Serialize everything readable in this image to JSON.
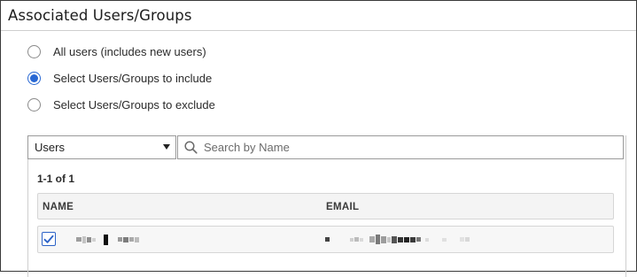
{
  "header": {
    "title": "Associated Users/Groups"
  },
  "options": [
    {
      "label": "All users (includes new users)",
      "selected": false
    },
    {
      "label": "Select Users/Groups to include",
      "selected": true
    },
    {
      "label": "Select Users/Groups to exclude",
      "selected": false
    }
  ],
  "filter": {
    "type_selected": "Users",
    "search_placeholder": "Search by Name"
  },
  "results": {
    "count_text": "1-1 of 1"
  },
  "table": {
    "columns": [
      "NAME",
      "EMAIL"
    ],
    "rows": [
      {
        "checked": true,
        "name": "",
        "email": ""
      }
    ]
  },
  "colors": {
    "accent": "#2867d3",
    "border": "#cfcfcf",
    "header_bg": "#f4f4f4"
  },
  "icons": {
    "search": "search-icon",
    "dropdown": "caret-down-icon",
    "check": "check-icon"
  }
}
